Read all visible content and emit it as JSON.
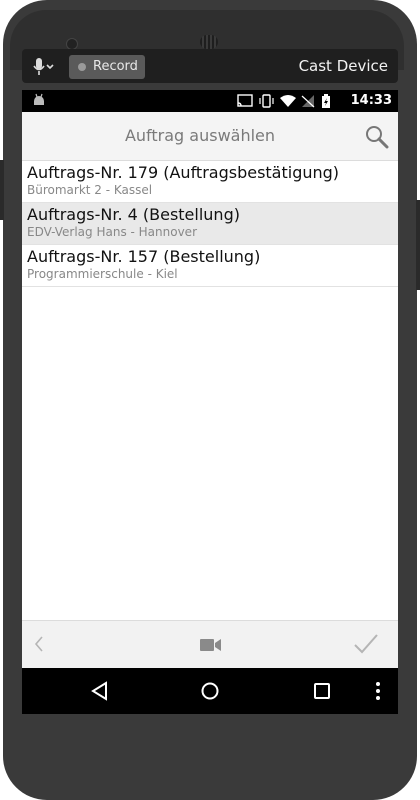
{
  "cast_bar": {
    "record_label": "Record",
    "cast_device_label": "Cast Device"
  },
  "status_bar": {
    "time": "14:33"
  },
  "header": {
    "title": "Auftrag auswählen"
  },
  "orders": [
    {
      "title": "Auftrags-Nr. 179 (Auftragsbestätigung)",
      "subtitle": "Büromarkt 2 - Kassel",
      "selected": false
    },
    {
      "title": "Auftrags-Nr. 4 (Bestellung)",
      "subtitle": "EDV-Verlag Hans - Hannover",
      "selected": true
    },
    {
      "title": "Auftrags-Nr. 157 (Bestellung)",
      "subtitle": "Programmierschule - Kiel",
      "selected": false
    }
  ],
  "colors": {
    "phone_body": "#3a3a3a",
    "header_bg": "#f4f4f4",
    "selected_row": "#e9e9e9"
  }
}
